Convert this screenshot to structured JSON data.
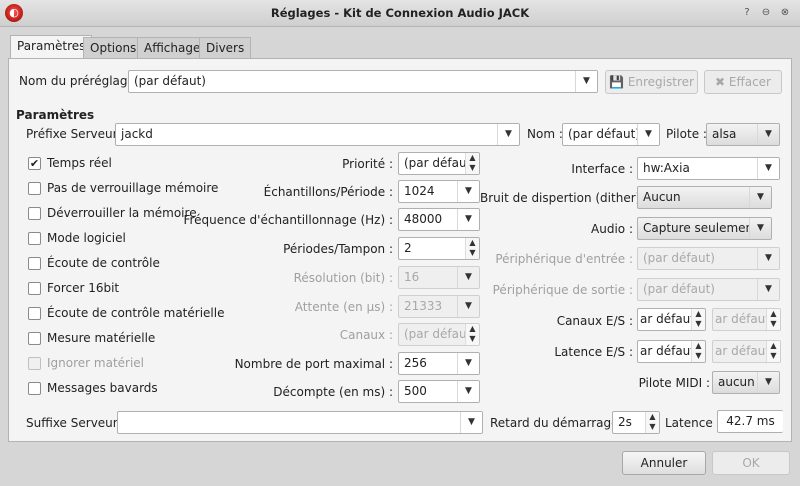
{
  "window": {
    "title": "Réglages - Kit de Connexion Audio JACK",
    "app_icon": "qjackctl-icon",
    "controls": [
      "help",
      "minimize",
      "close"
    ]
  },
  "tabs": [
    {
      "label": "Paramètres",
      "active": true
    },
    {
      "label": "Options"
    },
    {
      "label": "Affichage"
    },
    {
      "label": "Divers"
    }
  ],
  "preset": {
    "label": "Nom du préréglage :",
    "value": "(par défaut)",
    "save": "Enregistrer",
    "delete": "Effacer"
  },
  "section_title": "Paramètres",
  "server": {
    "prefix_label": "Préfixe Serveur :",
    "prefix_value": "jackd",
    "name_label": "Nom :",
    "name_value": "(par défaut)",
    "driver_label": "Pilote :",
    "driver_value": "alsa"
  },
  "checkboxes": [
    {
      "label": "Temps réel",
      "checked": true
    },
    {
      "label": "Pas de verrouillage mémoire",
      "checked": false
    },
    {
      "label": "Déverrouiller la mémoire",
      "checked": false
    },
    {
      "label": "Mode logiciel",
      "checked": false
    },
    {
      "label": "Écoute de contrôle",
      "checked": false
    },
    {
      "label": "Forcer 16bit",
      "checked": false
    },
    {
      "label": "Écoute de contrôle matérielle",
      "checked": false
    },
    {
      "label": "Mesure matérielle",
      "checked": false
    },
    {
      "label": "Ignorer matériel",
      "checked": false,
      "disabled": true
    },
    {
      "label": "Messages bavards",
      "checked": false
    }
  ],
  "mid": [
    {
      "label": "Priorité :",
      "value": "(par défaut)",
      "type": "spin"
    },
    {
      "label": "Échantillons/Période :",
      "value": "1024",
      "type": "combo"
    },
    {
      "label": "Fréquence d'échantillonnage (Hz) :",
      "value": "48000",
      "type": "combo"
    },
    {
      "label": "Périodes/Tampon :",
      "value": "2",
      "type": "spin"
    },
    {
      "label": "Résolution (bit) :",
      "value": "16",
      "type": "combo",
      "disabled": true
    },
    {
      "label": "Attente (en µs) :",
      "value": "21333",
      "type": "combo",
      "disabled": true
    },
    {
      "label": "Canaux :",
      "value": "(par défaut)",
      "type": "spin",
      "disabled": true
    },
    {
      "label": "Nombre de port maximal :",
      "value": "256",
      "type": "combo"
    },
    {
      "label": "Décompte (en ms) :",
      "value": "500",
      "type": "combo"
    }
  ],
  "right": {
    "interface": {
      "label": "Interface :",
      "value": "hw:Axia"
    },
    "dither": {
      "label": "Bruit de dispertion (dither) :",
      "value": "Aucun"
    },
    "audio": {
      "label": "Audio :",
      "value": "Capture seulement"
    },
    "input_device": {
      "label": "Périphérique d'entrée :",
      "value": "(par défaut)"
    },
    "output_device": {
      "label": "Périphérique de sortie :",
      "value": "(par défaut)"
    },
    "channels_io": {
      "label": "Canaux E/S :",
      "in": "ar défaut)",
      "out": "ar défaut)"
    },
    "latency_io": {
      "label": "Latence E/S :",
      "in": "ar défaut)",
      "out": "ar défaut)"
    },
    "midi": {
      "label": "Pilote MIDI :",
      "value": "aucun"
    }
  },
  "bottom": {
    "suffix_label": "Suffixe Serveur :",
    "suffix_value": "",
    "delay_label": "Retard du démarrage :",
    "delay_value": "2s",
    "latency_label": "Latence :",
    "latency_value": "42.7 ms"
  },
  "buttons": {
    "cancel": "Annuler",
    "ok": "OK"
  }
}
